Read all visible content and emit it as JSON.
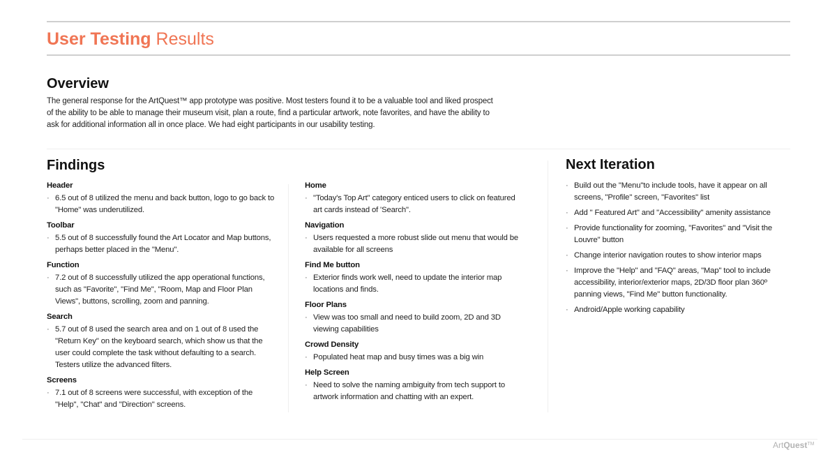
{
  "header": {
    "title_bold": "User Testing",
    "title_light": "Results"
  },
  "overview": {
    "heading": "Overview",
    "text": "The general response for the ArtQuest™ app prototype was positive. Most testers found it to be a valuable tool and liked prospect of the ability to be able to manage their museum visit, plan a route, find a particular artwork, note favorites, and have the ability to ask for additional information all in once place. We had eight participants in our usability testing."
  },
  "findings": {
    "heading": "Findings",
    "left_column": [
      {
        "title": "Header",
        "bullets": [
          "6.5 out of 8 utilized the menu and back button, logo to go back to \"Home\" was underutilized."
        ]
      },
      {
        "title": "Toolbar",
        "bullets": [
          "5.5 out of 8 successfully found the Art Locator and Map buttons, perhaps better placed in the \"Menu\"."
        ]
      },
      {
        "title": "Function",
        "bullets": [
          "7.2 out of 8 successfully utilized the app operational functions, such as \"Favorite\", \"Find Me\", \"Room, Map and Floor Plan Views\", buttons, scrolling, zoom and panning."
        ]
      },
      {
        "title": "Search",
        "bullets": [
          "5.7 out of 8 used the search area and on 1 out of 8 used the \"Return Key\" on the keyboard search, which show us that the user could complete the task without defaulting to a search. Testers utilize the advanced filters."
        ]
      },
      {
        "title": "Screens",
        "bullets": [
          "7.1 out of 8 screens were successful, with exception of the \"Help\", \"Chat\" and \"Direction\" screens."
        ]
      }
    ],
    "right_column": [
      {
        "title": "Home",
        "bullets": [
          "\"Today's Top Art\" category enticed users to click on featured art cards instead of 'Search\"."
        ]
      },
      {
        "title": "Navigation",
        "bullets": [
          "Users requested a more robust slide out menu that would be available for all screens"
        ]
      },
      {
        "title": "Find Me button",
        "bullets": [
          "Exterior finds work well, need to update the interior map locations and finds."
        ]
      },
      {
        "title": "Floor Plans",
        "bullets": [
          "View was too small and need to build zoom, 2D and 3D viewing capabilities"
        ]
      },
      {
        "title": "Crowd Density",
        "bullets": [
          "Populated heat map and busy times was a big win"
        ]
      },
      {
        "title": "Help Screen",
        "bullets": [
          "Need to solve the naming ambiguity from tech support to artwork information and chatting with an expert."
        ]
      }
    ]
  },
  "next_iteration": {
    "heading": "Next Iteration",
    "bullets": [
      "Build out the \"Menu\"to include tools, have it appear on all screens,  \"Profile\" screen, \"Favorites\" list",
      "Add \" Featured Art\" and \"Accessibility\" amenity assistance",
      "Provide functionality for zooming, \"Favorites\" and \"Visit the Louvre\" button",
      "Change interior navigation routes to show interior maps",
      "Improve the \"Help\" and \"FAQ\" areas, \"Map\" tool to include accessibility, interior/exterior maps, 2D/3D  floor plan 360º panning views, \"Find Me\" button functionality.",
      "Android/Apple working capability"
    ]
  },
  "footer": {
    "logo_light": "Art",
    "logo_bold": "Quest",
    "logo_tm": "TM"
  },
  "bullet_glyph": "·",
  "colors": {
    "accent": "#f07554",
    "text": "#222222",
    "rule": "#cfcfcf",
    "footer_logo": "#b3b3b3"
  }
}
